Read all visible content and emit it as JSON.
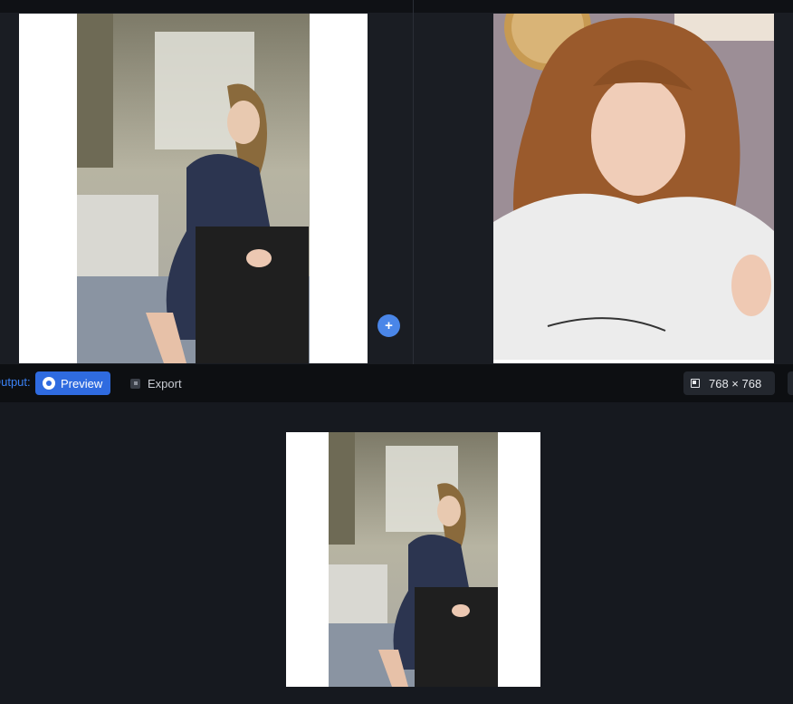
{
  "toolbar": {
    "output_label": "Output:",
    "preview_label": "Preview",
    "export_label": "Export",
    "dimensions": "768 × 768"
  },
  "icons": {
    "add": "plus-icon",
    "preview": "eye-icon",
    "export": "export-icon",
    "dimensions": "resize-icon"
  },
  "colors": {
    "accent": "#2f6be0",
    "add_button": "#4a86e8",
    "background": "#16191f",
    "toolbar": "#0d0f12"
  }
}
